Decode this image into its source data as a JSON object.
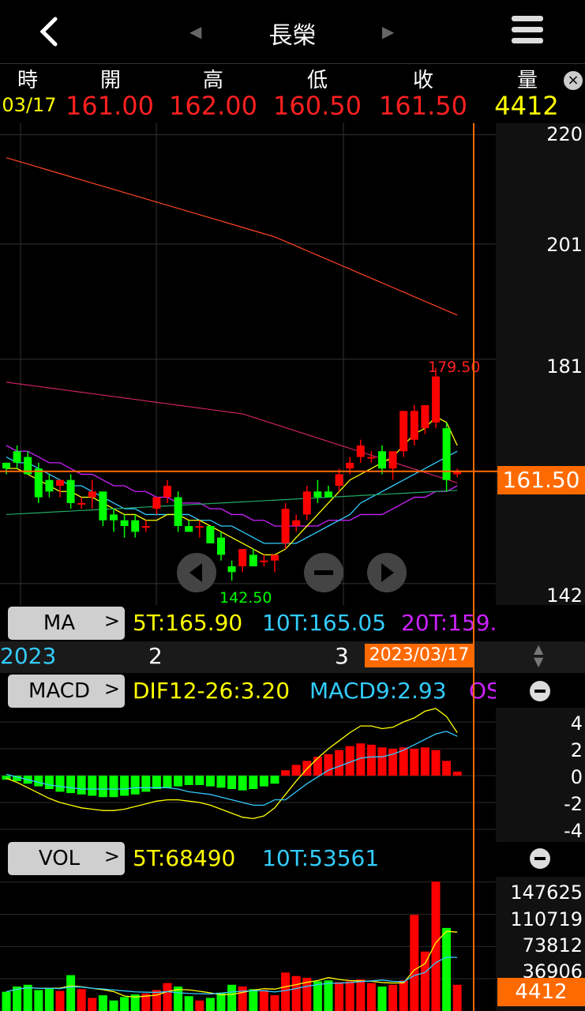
{
  "header": {
    "title": "長榮",
    "back_icon": "chevron-left-icon",
    "prev_icon": "triangle-left-icon",
    "next_icon": "triangle-right-icon",
    "menu_icon": "hamburger-menu-icon"
  },
  "quote": {
    "labels": {
      "time": "時",
      "open": "開",
      "high": "高",
      "low": "低",
      "close": "收",
      "volume": "量"
    },
    "values": {
      "time": "03/17",
      "open": "161.00",
      "high": "162.00",
      "low": "160.50",
      "close": "161.50",
      "volume": "4412"
    },
    "close_icon": "close-icon"
  },
  "price_axis": [
    "220",
    "201",
    "181",
    "161.50",
    "142"
  ],
  "annotations": {
    "high_mark": "179.50",
    "low_mark": "142.50"
  },
  "ma_bar": {
    "button": "MA",
    "ma5": "5T:165.90",
    "ma10": "10T:165.05",
    "ma20": "20T:159."
  },
  "date_bar": {
    "left": "2023",
    "m2": "2",
    "m3": "3",
    "current": "2023/03/17"
  },
  "macd_bar": {
    "button": "MACD",
    "dif": "DIF12-26:3.20",
    "macd": "MACD9:2.93",
    "osc": "OS"
  },
  "macd_axis": [
    "4",
    "2",
    "0",
    "-2",
    "-4"
  ],
  "vol_bar": {
    "button": "VOL",
    "v5": "5T:68490",
    "v10": "10T:53561"
  },
  "vol_axis": [
    "147625",
    "110719",
    "73812",
    "36906"
  ],
  "vol_current": "4412",
  "colors": {
    "up": "#ff0000",
    "down": "#00ff00",
    "ma5": "#ffff00",
    "ma10": "#33ccff",
    "ma20": "#cc22ff",
    "accent": "#ff6a00"
  },
  "chart_data": {
    "type": "candlestick",
    "price_range": [
      138,
      222
    ],
    "candles": [
      {
        "o": 163,
        "h": 163,
        "l": 161,
        "c": 162
      },
      {
        "o": 165,
        "h": 166,
        "l": 162,
        "c": 163
      },
      {
        "o": 164,
        "h": 165,
        "l": 161,
        "c": 161
      },
      {
        "o": 162,
        "h": 163,
        "l": 156,
        "c": 157
      },
      {
        "o": 160,
        "h": 161,
        "l": 157,
        "c": 158
      },
      {
        "o": 159,
        "h": 160,
        "l": 157,
        "c": 160
      },
      {
        "o": 160,
        "h": 161,
        "l": 155,
        "c": 156
      },
      {
        "o": 156,
        "h": 157,
        "l": 155,
        "c": 156
      },
      {
        "o": 157,
        "h": 160,
        "l": 155,
        "c": 158
      },
      {
        "o": 158,
        "h": 158,
        "l": 152,
        "c": 153
      },
      {
        "o": 154,
        "h": 155,
        "l": 151,
        "c": 153
      },
      {
        "o": 153,
        "h": 154,
        "l": 150,
        "c": 152
      },
      {
        "o": 153,
        "h": 154,
        "l": 150,
        "c": 151
      },
      {
        "o": 152,
        "h": 153,
        "l": 151,
        "c": 152
      },
      {
        "o": 155,
        "h": 157,
        "l": 154,
        "c": 157
      },
      {
        "o": 157,
        "h": 160,
        "l": 156,
        "c": 159
      },
      {
        "o": 157,
        "h": 158,
        "l": 151,
        "c": 152
      },
      {
        "o": 152,
        "h": 153,
        "l": 151,
        "c": 151
      },
      {
        "o": 152,
        "h": 153,
        "l": 150,
        "c": 152
      },
      {
        "o": 152,
        "h": 152,
        "l": 149,
        "c": 149
      },
      {
        "o": 150,
        "h": 151,
        "l": 146,
        "c": 147
      },
      {
        "o": 145,
        "h": 146,
        "l": 142.5,
        "c": 144
      },
      {
        "o": 145,
        "h": 148,
        "l": 144,
        "c": 148
      },
      {
        "o": 147,
        "h": 148,
        "l": 145,
        "c": 145
      },
      {
        "o": 146,
        "h": 147,
        "l": 145,
        "c": 146
      },
      {
        "o": 146,
        "h": 147,
        "l": 144,
        "c": 147
      },
      {
        "o": 149,
        "h": 156,
        "l": 148,
        "c": 155
      },
      {
        "o": 152,
        "h": 154,
        "l": 151,
        "c": 153
      },
      {
        "o": 154,
        "h": 159,
        "l": 153,
        "c": 158
      },
      {
        "o": 158,
        "h": 160,
        "l": 156,
        "c": 157
      },
      {
        "o": 158,
        "h": 159,
        "l": 157,
        "c": 157
      },
      {
        "o": 159,
        "h": 162,
        "l": 158,
        "c": 161
      },
      {
        "o": 162,
        "h": 164,
        "l": 161,
        "c": 163
      },
      {
        "o": 164,
        "h": 167,
        "l": 163,
        "c": 166
      },
      {
        "o": 164,
        "h": 165,
        "l": 163,
        "c": 164
      },
      {
        "o": 165,
        "h": 166,
        "l": 161,
        "c": 162
      },
      {
        "o": 162,
        "h": 165,
        "l": 160,
        "c": 165
      },
      {
        "o": 165,
        "h": 172,
        "l": 164,
        "c": 172
      },
      {
        "o": 167,
        "h": 173,
        "l": 166,
        "c": 172
      },
      {
        "o": 169,
        "h": 173,
        "l": 168,
        "c": 173
      },
      {
        "o": 170,
        "h": 179.5,
        "l": 169,
        "c": 178
      },
      {
        "o": 169,
        "h": 170,
        "l": 158,
        "c": 160
      },
      {
        "o": 161,
        "h": 162,
        "l": 160.5,
        "c": 161.5
      }
    ],
    "ma5": [
      162,
      162,
      161,
      160,
      159,
      158,
      158,
      157,
      157,
      156,
      155,
      154,
      154,
      153,
      153,
      154,
      154,
      153,
      153,
      152,
      151,
      150,
      149,
      148,
      147,
      147,
      148,
      150,
      152,
      154,
      156,
      158,
      160,
      161,
      162,
      163,
      164,
      166,
      168,
      169,
      171,
      170,
      166
    ],
    "ma10": [
      164,
      163,
      163,
      162,
      161,
      160,
      159,
      159,
      158,
      157,
      156,
      155,
      155,
      154,
      154,
      154,
      154,
      154,
      153,
      153,
      152,
      152,
      151,
      150,
      149,
      149,
      149,
      149,
      150,
      151,
      152,
      153,
      154,
      156,
      157,
      158,
      159,
      160,
      161,
      162,
      163,
      164,
      165
    ],
    "ma20": [
      166,
      165,
      165,
      164,
      163,
      163,
      162,
      161,
      161,
      160,
      159,
      159,
      158,
      158,
      157,
      157,
      156,
      156,
      156,
      155,
      155,
      154,
      154,
      153,
      153,
      152,
      152,
      152,
      152,
      152,
      153,
      153,
      153,
      154,
      154,
      154,
      155,
      156,
      157,
      157,
      158,
      158,
      159
    ],
    "macd_hist": [
      -0.3,
      -0.4,
      -0.6,
      -0.8,
      -1.0,
      -1.2,
      -1.3,
      -1.4,
      -1.5,
      -1.6,
      -1.6,
      -1.5,
      -1.4,
      -1.2,
      -1.0,
      -0.9,
      -0.8,
      -0.7,
      -0.7,
      -0.8,
      -0.9,
      -1.0,
      -1.1,
      -1.0,
      -0.8,
      -0.6,
      0.4,
      0.8,
      1.1,
      1.4,
      1.6,
      1.9,
      2.2,
      2.4,
      2.3,
      2.1,
      2.0,
      2.1,
      2.0,
      2.1,
      1.9,
      1.1,
      0.3
    ],
    "dif": [
      -0.2,
      -0.5,
      -0.9,
      -1.3,
      -1.7,
      -2.0,
      -2.2,
      -2.4,
      -2.5,
      -2.6,
      -2.6,
      -2.5,
      -2.3,
      -2.1,
      -1.9,
      -1.8,
      -1.8,
      -1.9,
      -2.0,
      -2.2,
      -2.5,
      -2.8,
      -3.1,
      -3.2,
      -3.0,
      -2.4,
      -1.4,
      -0.4,
      0.5,
      1.3,
      2.0,
      2.6,
      3.2,
      3.7,
      3.7,
      3.5,
      3.6,
      4.0,
      4.3,
      4.8,
      5.0,
      4.4,
      3.2
    ],
    "macd9": [
      0.1,
      -0.1,
      -0.3,
      -0.5,
      -0.7,
      -0.8,
      -0.9,
      -1.0,
      -1.0,
      -1.0,
      -1.0,
      -1.0,
      -0.9,
      -0.9,
      -0.9,
      -0.9,
      -1.0,
      -1.2,
      -1.3,
      -1.4,
      -1.6,
      -1.8,
      -2.0,
      -2.2,
      -2.2,
      -1.8,
      -1.8,
      -1.2,
      -0.6,
      -0.1,
      0.4,
      0.7,
      1.0,
      1.3,
      1.4,
      1.4,
      1.6,
      1.9,
      2.3,
      2.7,
      3.1,
      3.3,
      2.93
    ],
    "volume": [
      22000,
      28000,
      30000,
      24000,
      26000,
      23000,
      41000,
      25000,
      15000,
      18000,
      12000,
      16000,
      19000,
      20000,
      24000,
      32000,
      28000,
      17000,
      12000,
      15000,
      21000,
      30000,
      28000,
      25000,
      24000,
      18000,
      44000,
      40000,
      38000,
      34000,
      35000,
      33000,
      34000,
      36000,
      32000,
      28000,
      30000,
      35000,
      110000,
      68000,
      148000,
      95000,
      30000
    ]
  }
}
